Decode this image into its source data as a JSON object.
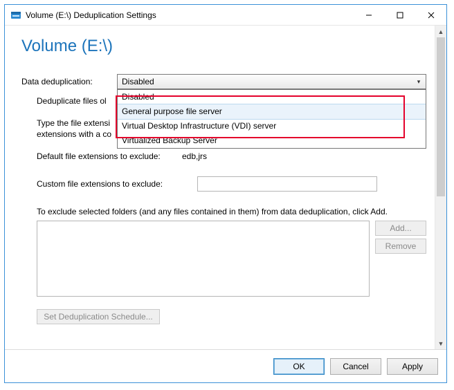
{
  "window": {
    "title": "Volume (E:\\) Deduplication Settings"
  },
  "header": {
    "title": "Volume (E:\\)"
  },
  "dedup": {
    "label": "Data deduplication:",
    "selected": "Disabled",
    "options": [
      "Disabled",
      "General purpose file server",
      "Virtual Desktop Infrastructure (VDI) server",
      "Virtualized Backup Server"
    ]
  },
  "age": {
    "text_partial": "Deduplicate files ol"
  },
  "ext_help": {
    "line1_partial": "Type the file extensi",
    "line2_partial": "extensions with a co"
  },
  "default_ext": {
    "label": "Default file extensions to exclude:",
    "value": "edb,jrs"
  },
  "custom_ext": {
    "label": "Custom file extensions to exclude:",
    "value": ""
  },
  "folders": {
    "help": "To exclude selected folders (and any files contained in them) from data deduplication, click Add.",
    "add_label": "Add...",
    "remove_label": "Remove"
  },
  "schedule": {
    "button_label": "Set Deduplication Schedule..."
  },
  "footer": {
    "ok": "OK",
    "cancel": "Cancel",
    "apply": "Apply"
  }
}
